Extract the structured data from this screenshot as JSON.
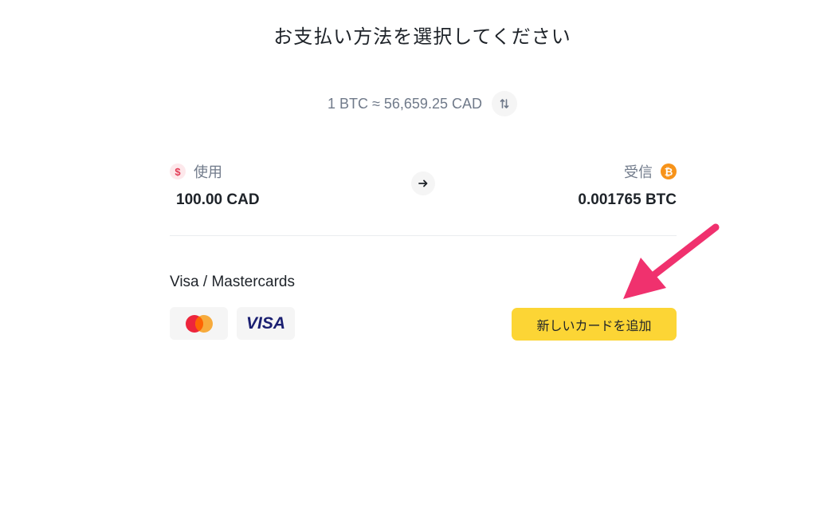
{
  "header": {
    "title": "お支払い方法を選択してください"
  },
  "rate": {
    "text": "1 BTC ≈ 56,659.25 CAD"
  },
  "spend": {
    "label": "使用",
    "amount": "100.00 CAD",
    "icon_glyph": "$",
    "icon": "usd-coin-icon",
    "icon_color": "#e23b55"
  },
  "receive": {
    "label": "受信",
    "amount": "0.001765 BTC",
    "icon_glyph": "₿",
    "icon": "bitcoin-icon",
    "icon_color": "#f7931a"
  },
  "payment": {
    "section_title": "Visa / Mastercards",
    "visa_label": "VISA",
    "add_card_label": "新しいカードを追加",
    "button_color": "#fcd535"
  },
  "annotation": {
    "arrow_color": "#f0316e"
  }
}
